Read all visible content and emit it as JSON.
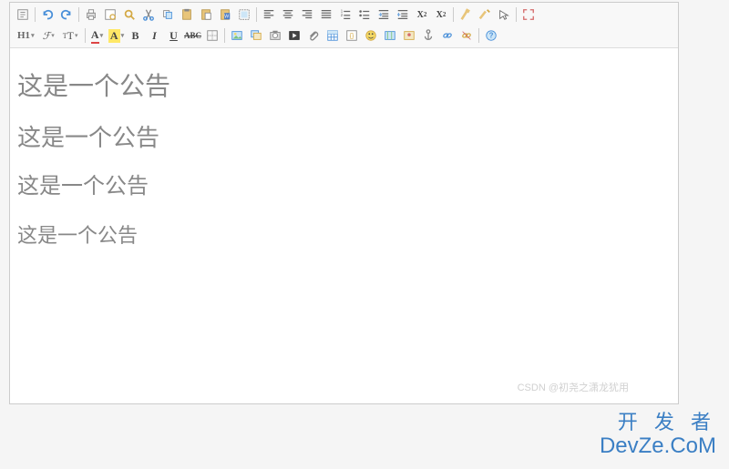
{
  "toolbar": {
    "row1": {
      "source": "⊞",
      "undo": "↶",
      "redo": "↷",
      "print": "⎙",
      "preview": "⊡",
      "find": "🔍",
      "cut": "✂",
      "copy": "⧉",
      "paste": "📋",
      "paste_plain": "📋",
      "paste_word": "📋",
      "select_all": "▦",
      "align_left": "≡",
      "align_center": "≡",
      "align_right": "≡",
      "align_justify": "≡",
      "list_ordered": "≡",
      "list_unordered": "≡",
      "indent": "⇥",
      "outdent": "⇤",
      "subscript": "X₂",
      "superscript": "X²",
      "clear_format": "✎",
      "quickformat": "✎",
      "select_element": "↖",
      "fullscreen": "⛶"
    },
    "row2": {
      "heading": "H1",
      "font_family": "ℱ",
      "font_size": "ᴛT",
      "font_color": "A",
      "back_color": "A",
      "bold": "B",
      "italic": "I",
      "underline": "U",
      "strike": "ABC",
      "border": "⊞",
      "insert_image": "🖼",
      "multi_image": "🖼",
      "snapshot": "📷",
      "video": "▶",
      "attachment": "📎",
      "insert_table": "▦",
      "code": "{}",
      "emoticon": "☺",
      "map": "🗺",
      "gmap": "📍",
      "anchor": "⚓",
      "link": "🔗",
      "unlink": "⧸",
      "help": "?"
    }
  },
  "content": {
    "lines": [
      "这是一个公告",
      "这是一个公告",
      "这是一个公告",
      "这是一个公告"
    ]
  },
  "watermark": {
    "line1": "开 发 者",
    "line2": "DevZe.CoM",
    "faint": "CSDN @初尧之潇龙犹用"
  }
}
